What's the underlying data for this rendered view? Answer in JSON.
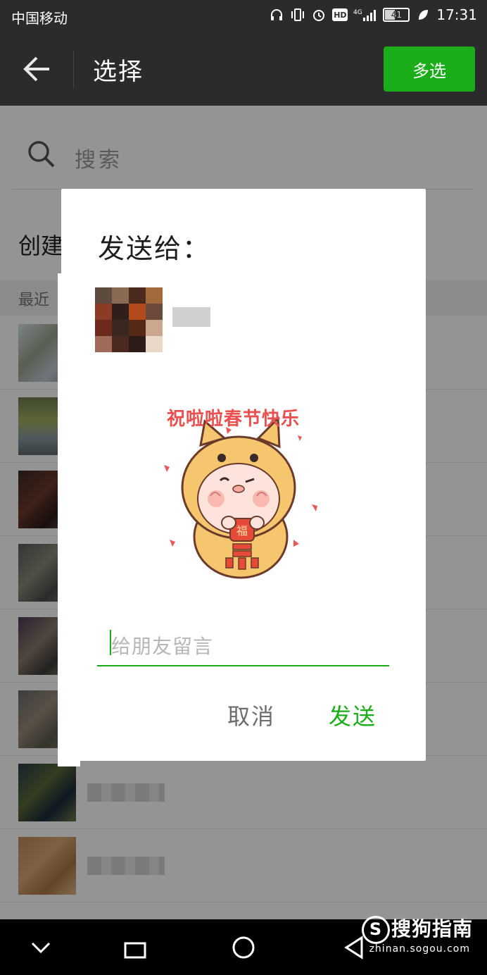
{
  "status_bar": {
    "carrier": "中国移动",
    "network": "4G",
    "hd": "HD",
    "battery": "41",
    "time": "17:31"
  },
  "top_bar": {
    "back_icon": "arrow-left-icon",
    "title": "选择",
    "multi_select_label": "多选",
    "accent": "#1aad19"
  },
  "search": {
    "placeholder": "搜索",
    "icon": "search-icon"
  },
  "list": {
    "create_label": "创建",
    "section_label": "最近",
    "rows": 8
  },
  "dialog": {
    "title": "发送给：",
    "sticker_caption": "祝啦啦春节快乐",
    "message_placeholder": "给朋友留言",
    "cancel_label": "取消",
    "send_label": "发送"
  },
  "watermark": {
    "brand": "搜狗指南",
    "domain": "zhinan.sogou.com"
  }
}
